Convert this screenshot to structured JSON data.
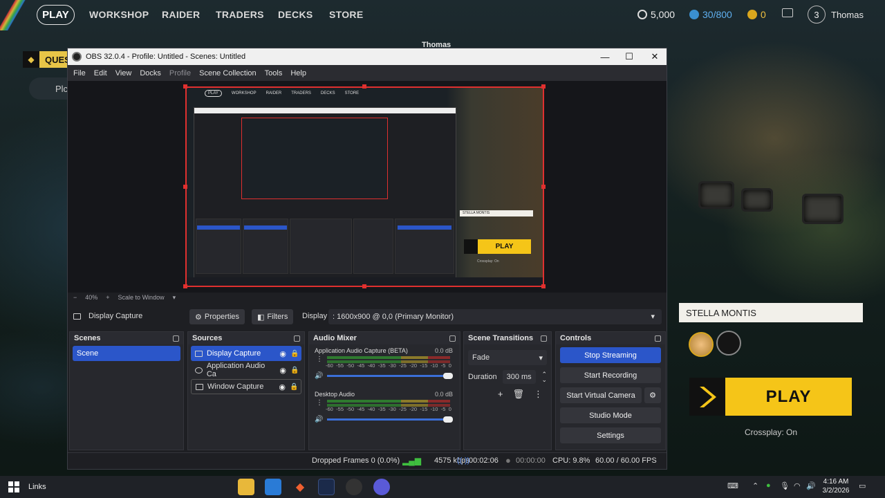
{
  "game": {
    "nav": {
      "play": "PLAY",
      "links": [
        "WORKSHOP",
        "RAIDER",
        "TRADERS",
        "DECKS",
        "STORE"
      ],
      "coins": "5,000",
      "credits": "30/800",
      "tokens": "0",
      "user_level": "3",
      "username": "Thomas"
    },
    "overlay_username": "Thomas",
    "quest_tab": "QUES",
    "quest_item": "Plc",
    "party_card_name": "STELLA MONTIS",
    "play_button": "PLAY",
    "crossplay": "Crossplay: On"
  },
  "obs": {
    "title": "OBS 32.0.4 - Profile: Untitled - Scenes: Untitled",
    "menu": [
      "File",
      "Edit",
      "View",
      "Docks",
      "Profile",
      "Scene Collection",
      "Tools",
      "Help"
    ],
    "zoom": {
      "minus": "−",
      "level": "40%",
      "plus": "+",
      "mode": "Scale to Window"
    },
    "source_toolbar": {
      "current_source": "Display Capture",
      "properties": "Properties",
      "filters": "Filters",
      "display_label": "Display",
      "display_value": ": 1600x900 @ 0,0 (Primary Monitor)"
    },
    "scenes": {
      "title": "Scenes",
      "items": [
        "Scene"
      ]
    },
    "sources": {
      "title": "Sources",
      "items": [
        "Display Capture",
        "Application Audio Ca",
        "Window Capture"
      ]
    },
    "mixer": {
      "title": "Audio Mixer",
      "channels": [
        {
          "name": "Application Audio Capture (BETA)",
          "db": "0.0 dB",
          "level": 0.55
        },
        {
          "name": "Desktop Audio",
          "db": "0.0 dB",
          "level": 0.7
        }
      ],
      "scale": [
        "-60",
        "-55",
        "-50",
        "-45",
        "-40",
        "-35",
        "-30",
        "-25",
        "-20",
        "-15",
        "-10",
        "-5",
        "0"
      ]
    },
    "transitions": {
      "title": "Scene Transitions",
      "type": "Fade",
      "duration_label": "Duration",
      "duration_value": "300 ms"
    },
    "controls": {
      "title": "Controls",
      "stop_streaming": "Stop Streaming",
      "start_recording": "Start Recording",
      "start_virtual_camera": "Start Virtual Camera",
      "studio_mode": "Studio Mode",
      "settings": "Settings"
    },
    "status": {
      "dropped": "Dropped Frames 0 (0.0%)",
      "bitrate": "4575 kbps",
      "stream_time": "00:02:06",
      "record_time": "00:00:00",
      "cpu": "CPU: 9.8%",
      "fps": "60.00 / 60.00 FPS"
    },
    "preview_inner": {
      "nav_links": [
        "PLAY",
        "WORKSHOP",
        "RAIDER",
        "TRADERS",
        "DECKS",
        "STORE"
      ],
      "card_name": "STELLA MONTIS",
      "play": "PLAY",
      "crossplay": "Crossplay: On"
    }
  },
  "taskbar": {
    "links_label": "Links",
    "time": "4:16 AM",
    "date": "3/2/2026"
  },
  "colors": {
    "accent_blue": "#2b56c9",
    "preview_border": "#e0302f",
    "game_yellow": "#f5c518"
  }
}
